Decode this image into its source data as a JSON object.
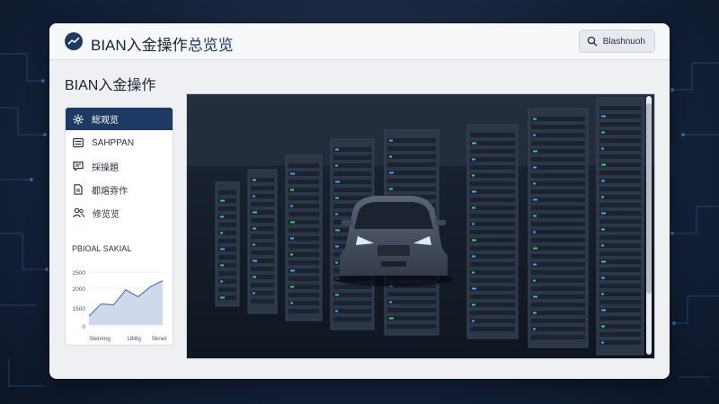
{
  "window": {
    "title_prefix": "BIAN入金操作",
    "title_suffix": "总览览",
    "search_label": "Blashnuoh"
  },
  "page": {
    "title": "BIAN入金操作"
  },
  "sidebar": {
    "items": [
      {
        "label": "総观览",
        "icon": "gear-icon",
        "active": true
      },
      {
        "label": "SAHPPAN",
        "icon": "list-icon",
        "active": false
      },
      {
        "label": "採操題",
        "icon": "message-icon",
        "active": false
      },
      {
        "label": "都熔雰作",
        "icon": "document-icon",
        "active": false
      },
      {
        "label": "修览览",
        "icon": "users-icon",
        "active": false
      }
    ]
  },
  "mini_chart": {
    "title": "PBIOAL SAKIAL",
    "chart_data": {
      "type": "area",
      "title": "PBIOAL SAKIAL",
      "x_labels": [
        "Stenimg",
        "18l8g",
        "Sknet"
      ],
      "y_ticks": [
        "2500",
        "2000",
        "1500",
        "0"
      ],
      "x": [
        0,
        1,
        2,
        3,
        4,
        5,
        6
      ],
      "values": [
        450,
        1050,
        1000,
        1750,
        1400,
        1900,
        2200
      ],
      "ylim": [
        0,
        2500
      ],
      "grid": true,
      "color": "#5b79a8"
    }
  },
  "viewer": {
    "image": "server-room-with-car",
    "colors": {
      "rack": "#2b3646",
      "led_green": "#35d07f",
      "led_blue": "#4aa3ff",
      "car": "#4a5568"
    }
  },
  "colors": {
    "accent": "#1e3a64",
    "window_bg": "#eef0f3"
  }
}
